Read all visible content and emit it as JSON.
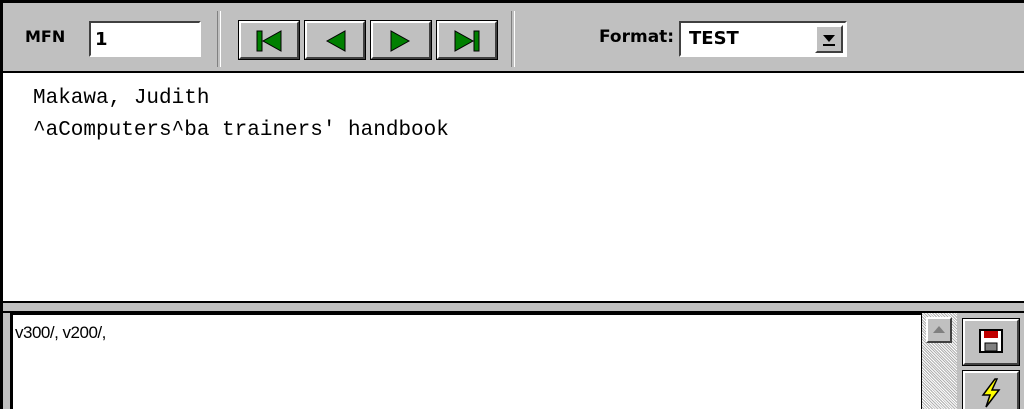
{
  "toolbar": {
    "mfn_label": "MFN",
    "mfn_value": "1",
    "format_label": "Format:",
    "format_value": "TEST"
  },
  "output": {
    "lines": [
      "Makawa, Judith",
      "^aComputers^ba trainers' handbook"
    ]
  },
  "editor": {
    "text": "v300/, v200/,"
  },
  "colors": {
    "window_bg": "#c0c0c0",
    "nav_arrow": "#008000",
    "save_icon": "#c00000",
    "run_icon": "#ffff00"
  }
}
